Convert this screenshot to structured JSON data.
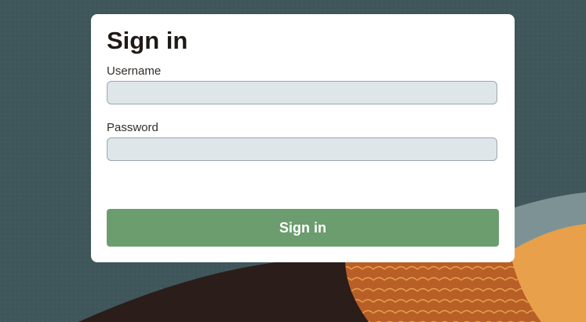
{
  "login": {
    "title": "Sign in",
    "username_label": "Username",
    "username_value": "",
    "password_label": "Password",
    "password_value": "",
    "submit_label": "Sign in"
  },
  "colors": {
    "background": "#3f565b",
    "dark_wave": "#2a1d1a",
    "orange_wave": "#b85f28",
    "light_orange": "#e9a04a",
    "button": "#6c9d6f",
    "input_fill": "#dfe6e9"
  }
}
